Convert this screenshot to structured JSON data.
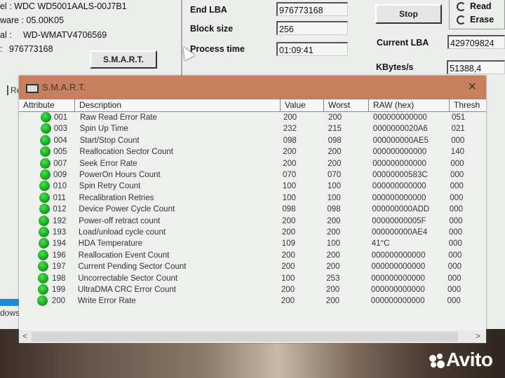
{
  "drive_info": {
    "model_label": "el : WDC WD5001AALS-00J7B1",
    "firmware_label": "ware : 05.00K05",
    "serial_label": "al :",
    "serial_value": "WD-WMATV4706569",
    "lba_label": ":",
    "lba_value": "976773168",
    "smart_button": "S.M.A.R.T."
  },
  "test_params": {
    "end_lba_label": "End LBA",
    "end_lba_value": "976773168",
    "block_size_label": "Block size",
    "block_size_value": "256",
    "process_time_label": "Process time",
    "process_time_value": "01:09:41"
  },
  "controls": {
    "stop_button": "Stop",
    "radio_read": "Read",
    "radio_erase": "Erase",
    "current_lba_label": "Current LBA",
    "current_lba_value": "429709824",
    "kbytes_label": "KBytes/s",
    "kbytes_value": "51388,4"
  },
  "background": {
    "tab_fragment": "Re",
    "windows_fragment": "dows"
  },
  "smart_window": {
    "title": "S.M.A.R.T.",
    "close_icon": "×",
    "columns": [
      "Attribute",
      "Description",
      "Value",
      "Worst",
      "RAW (hex)",
      "Thresh"
    ],
    "rows": [
      {
        "id": "001",
        "desc": "Raw Read Error Rate",
        "value": "200",
        "worst": "200",
        "raw": "000000000000",
        "thresh": "051",
        "status": "ok"
      },
      {
        "id": "003",
        "desc": "Spin Up Time",
        "value": "232",
        "worst": "215",
        "raw": "0000000020A6",
        "thresh": "021",
        "status": "ok"
      },
      {
        "id": "004",
        "desc": "Start/Stop Count",
        "value": "098",
        "worst": "098",
        "raw": "000000000AE5",
        "thresh": "000",
        "status": "ok"
      },
      {
        "id": "005",
        "desc": "Reallocation Sector Count",
        "value": "200",
        "worst": "200",
        "raw": "000000000000",
        "thresh": "140",
        "status": "ok"
      },
      {
        "id": "007",
        "desc": "Seek Error Rate",
        "value": "200",
        "worst": "200",
        "raw": "000000000000",
        "thresh": "000",
        "status": "ok"
      },
      {
        "id": "009",
        "desc": "PowerOn Hours Count",
        "value": "070",
        "worst": "070",
        "raw": "00000000583C",
        "thresh": "000",
        "status": "ok"
      },
      {
        "id": "010",
        "desc": "Spin Retry Count",
        "value": "100",
        "worst": "100",
        "raw": "000000000000",
        "thresh": "000",
        "status": "ok"
      },
      {
        "id": "011",
        "desc": "Recalibration Retries",
        "value": "100",
        "worst": "100",
        "raw": "000000000000",
        "thresh": "000",
        "status": "ok"
      },
      {
        "id": "012",
        "desc": "Device Power Cycle Count",
        "value": "098",
        "worst": "098",
        "raw": "000000000ADD",
        "thresh": "000",
        "status": "ok"
      },
      {
        "id": "192",
        "desc": "Power-off retract count",
        "value": "200",
        "worst": "200",
        "raw": "00000000005F",
        "thresh": "000",
        "status": "ok"
      },
      {
        "id": "193",
        "desc": "Load/unload cycle count",
        "value": "200",
        "worst": "200",
        "raw": "000000000AE4",
        "thresh": "000",
        "status": "ok"
      },
      {
        "id": "194",
        "desc": "HDA Temperature",
        "value": "109",
        "worst": "100",
        "raw": "41°C",
        "thresh": "000",
        "status": "ok"
      },
      {
        "id": "196",
        "desc": "Reallocation Event Count",
        "value": "200",
        "worst": "200",
        "raw": "000000000000",
        "thresh": "000",
        "status": "ok"
      },
      {
        "id": "197",
        "desc": "Current Pending Sector Count",
        "value": "200",
        "worst": "200",
        "raw": "000000000000",
        "thresh": "000",
        "status": "ok"
      },
      {
        "id": "198",
        "desc": "Uncorrectable Sector Count",
        "value": "100",
        "worst": "253",
        "raw": "000000000000",
        "thresh": "000",
        "status": "ok"
      },
      {
        "id": "199",
        "desc": "UltraDMA CRC Error Count",
        "value": "200",
        "worst": "200",
        "raw": "000000000000",
        "thresh": "000",
        "status": "ok"
      },
      {
        "id": "200",
        "desc": "Write Error Rate",
        "value": "200",
        "worst": "200",
        "raw": "000000000000",
        "thresh": "000",
        "status": "ok"
      }
    ],
    "scroll_left": "<",
    "scroll_right": ">"
  },
  "colors": {
    "title_bar": "#c77f5e",
    "status_ok": "#1aa82a"
  },
  "watermark": "Avito"
}
